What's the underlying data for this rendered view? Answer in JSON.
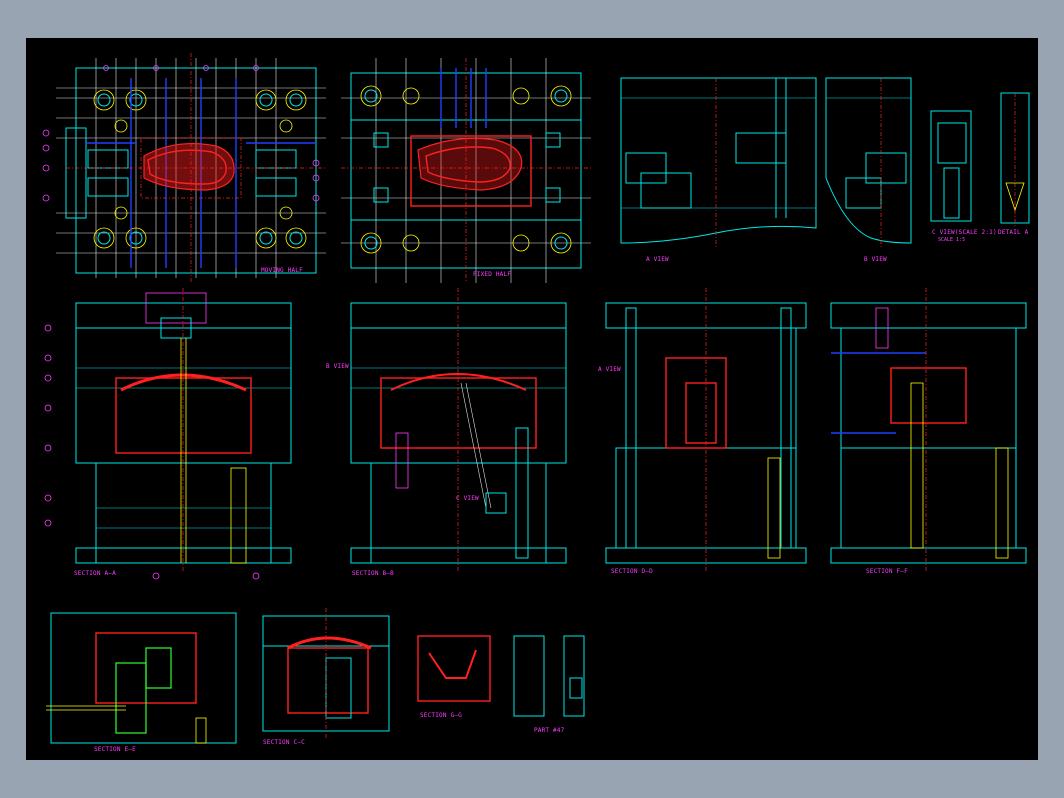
{
  "sheet": {
    "background": "#000000",
    "frame_color": "#98a4b2"
  },
  "colors": {
    "outline": "#00e6e6",
    "part": "#ff2020",
    "label": "#ff3cff",
    "ejector": "#ffff00",
    "cooling": "#2040ff",
    "slide": "#30ff30"
  },
  "views": {
    "moving_half": "MOVING HALF",
    "fixed_half": "FIXED HALF",
    "a_view": "A VIEW",
    "b_view": "B VIEW",
    "c_view": "C VIEW(SCALE 2:1)",
    "c_scale": "SCALE 1:5",
    "detail_a": "DETAIL A",
    "section_a": "SECTION A—A",
    "section_b": "SECTION B—B",
    "section_d": "SECTION D—D",
    "section_f": "SECTION F—F",
    "section_e": "SECTION E—E",
    "section_c": "SECTION C—C",
    "section_g": "SECTION G—G",
    "part": "PART #47",
    "a_view_callout": "A VIEW",
    "b_view_callout": "B VIEW",
    "c_view_callout": "C VIEW"
  }
}
